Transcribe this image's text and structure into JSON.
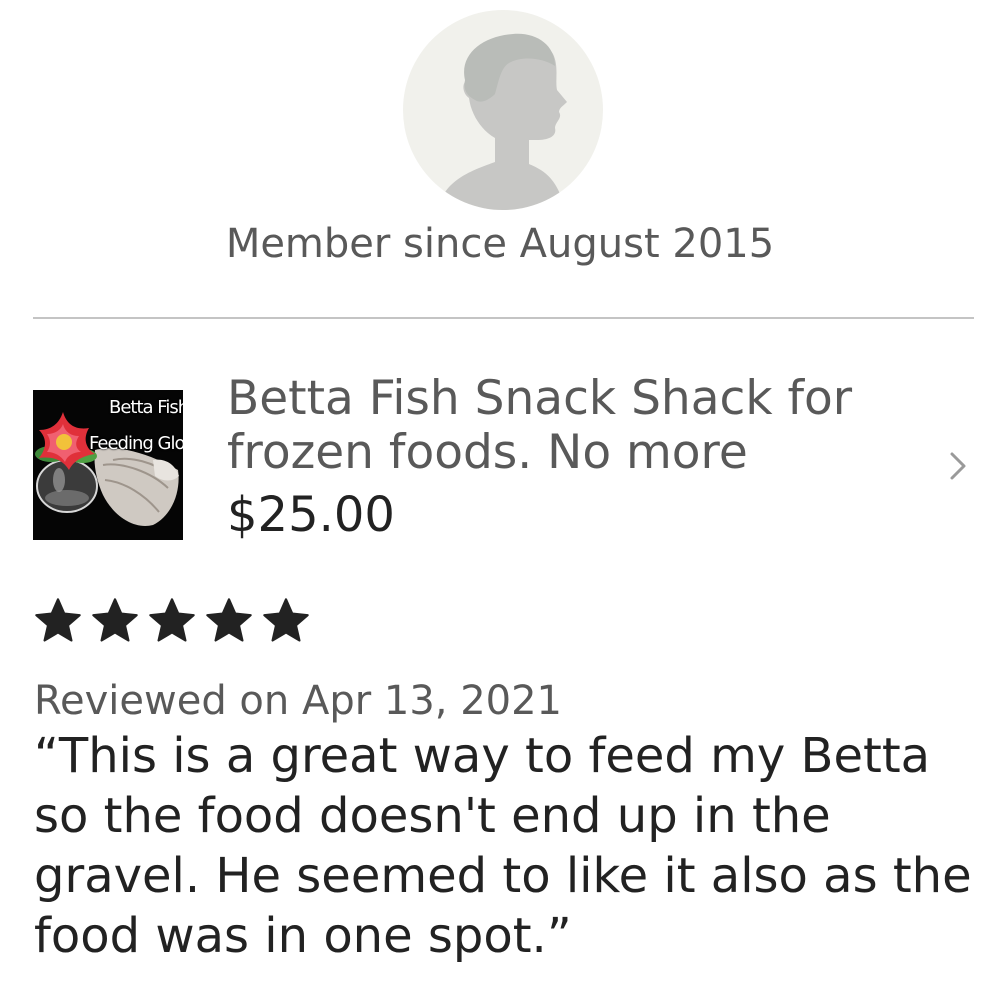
{
  "profile": {
    "avatar_icon": "default-user-silhouette-icon",
    "member_since": "Member since August 2015"
  },
  "listing": {
    "thumbnail_text_line1": "Betta Fish",
    "thumbnail_text_line2": "Feeding Glob",
    "title": "Betta Fish Snack Shack for\nfrozen foods. No more",
    "price": "$25.00",
    "chevron_icon": "chevron-right-icon"
  },
  "review": {
    "rating": 5,
    "rating_max": 5,
    "star_color": "#222222",
    "reviewed_on": "Reviewed on Apr 13, 2021",
    "text": "“This is a great way to feed my Betta so the food doesn't end up in the gravel. He seemed to like it also as the food was in one spot.”"
  }
}
